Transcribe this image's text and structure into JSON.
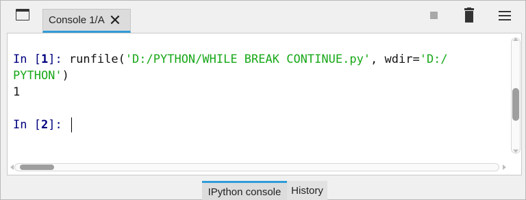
{
  "toolbar": {
    "undock_icon": "undock-window-icon",
    "stop_icon": "stop-icon",
    "trash_icon": "trash-icon",
    "menu_icon": "hamburger-menu-icon"
  },
  "tab": {
    "label": "Console 1/A",
    "close_glyph": "✕"
  },
  "console": {
    "lines": [
      {
        "prompt": "In [",
        "num": "1",
        "prompt_end": "]: ",
        "code_pre": "runfile(",
        "str1": "'D:/PYTHON/WHILE BREAK CONTINUE.py'",
        "code_mid": ", wdir=",
        "str2_a": "'D:/"
      },
      {
        "str2_b": "PYTHON'",
        "code_end": ")"
      },
      {
        "output": "1"
      },
      {
        "blank": ""
      },
      {
        "prompt": "In [",
        "num": "2",
        "prompt_end": "]: "
      }
    ]
  },
  "bottom_tabs": {
    "ipython_label": "IPython console",
    "history_label": "History"
  },
  "colors": {
    "accent": "#2f9bd7",
    "string": "#18a818",
    "prompt": "#000080"
  }
}
